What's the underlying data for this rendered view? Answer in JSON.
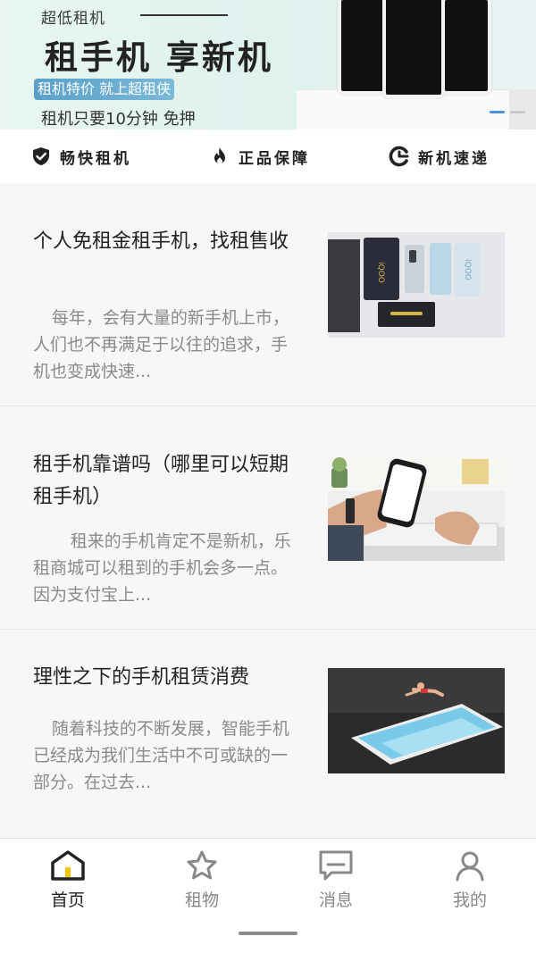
{
  "banner": {
    "subtitle": "超低租机",
    "title": "租手机 享新机",
    "tag": "租机特价 就上超租侠",
    "note": "租机只要10分钟 免押"
  },
  "features": [
    {
      "icon": "shield-check-icon",
      "label": "畅快租机"
    },
    {
      "icon": "flame-icon",
      "label": "正品保障"
    },
    {
      "icon": "fast-delivery-icon",
      "label": "新机速递"
    }
  ],
  "articles": [
    {
      "title": "个人免租金租手机，找租售收",
      "excerpt": "每年，会有大量的新手机上市，人们也不再满足于以往的追求，手机也变成快速...",
      "image": "phones-flatlay-image"
    },
    {
      "title": "租手机靠谱吗（哪里可以短期租手机）",
      "excerpt": "租来的手机肯定不是新机，乐租商城可以租到的手机会多一点。因为支付宝上...",
      "image": "hand-holding-phone-image"
    },
    {
      "title": "理性之下的手机租赁消费",
      "excerpt": "随着科技的不断发展，智能手机已经成为我们生活中不可或缺的一部分。在过去...",
      "image": "diver-phone-pool-image"
    }
  ],
  "tabbar": {
    "items": [
      {
        "label": "首页",
        "icon": "home-icon",
        "active": true
      },
      {
        "label": "租物",
        "icon": "star-icon",
        "active": false
      },
      {
        "label": "消息",
        "icon": "message-icon",
        "active": false
      },
      {
        "label": "我的",
        "icon": "user-icon",
        "active": false
      }
    ]
  },
  "colors": {
    "accent": "#4a90e2",
    "active_tab": "#222222",
    "inactive_tab": "#888888",
    "home_icon_yellow": "#f5c400"
  }
}
